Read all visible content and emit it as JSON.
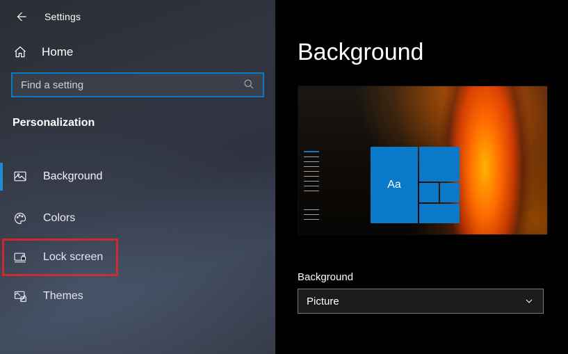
{
  "window": {
    "title": "Settings"
  },
  "home": {
    "label": "Home"
  },
  "search": {
    "placeholder": "Find a setting"
  },
  "section": {
    "title": "Personalization"
  },
  "nav": {
    "items": [
      {
        "id": "background",
        "label": "Background",
        "selected": true
      },
      {
        "id": "colors",
        "label": "Colors"
      },
      {
        "id": "lockscreen",
        "label": "Lock screen",
        "highlighted": true
      },
      {
        "id": "themes",
        "label": "Themes"
      }
    ]
  },
  "main": {
    "page_title": "Background",
    "preview_tile_text": "Aa",
    "background_label": "Background",
    "background_dropdown": {
      "selected": "Picture"
    }
  }
}
